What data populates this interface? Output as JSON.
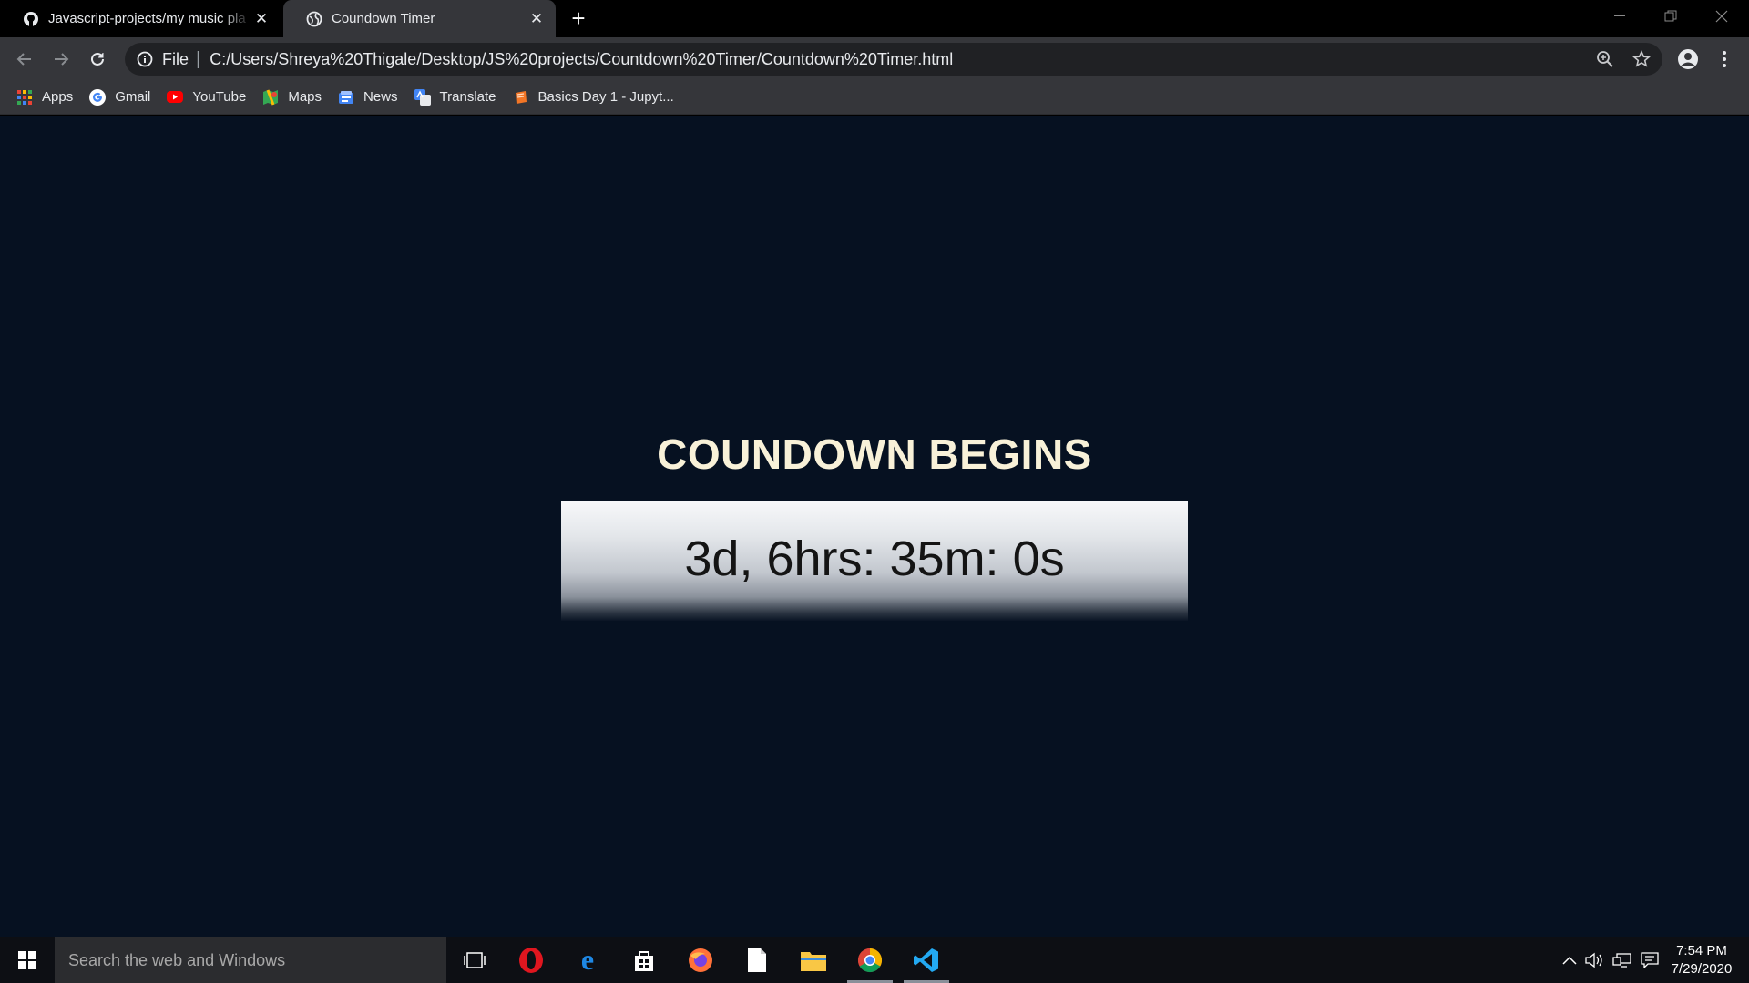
{
  "browser": {
    "tabs": [
      {
        "title": "Javascript-projects/my music pla",
        "active": false,
        "icon": "github-icon"
      },
      {
        "title": "Coundown Timer",
        "active": true,
        "icon": "globe-icon"
      }
    ],
    "omnibox": {
      "scheme_label": "File",
      "url": "C:/Users/Shreya%20Thigale/Desktop/JS%20projects/Countdown%20Timer/Countdown%20Timer.html"
    },
    "bookmarks": [
      {
        "label": "Apps",
        "icon": "apps-grid-icon"
      },
      {
        "label": "Gmail",
        "icon": "google-icon"
      },
      {
        "label": "YouTube",
        "icon": "youtube-icon"
      },
      {
        "label": "Maps",
        "icon": "maps-icon"
      },
      {
        "label": "News",
        "icon": "news-icon"
      },
      {
        "label": "Translate",
        "icon": "translate-icon"
      },
      {
        "label": "Basics Day 1 - Jupyt...",
        "icon": "jupyter-icon"
      }
    ]
  },
  "page": {
    "heading": "COUNDOWN BEGINS",
    "timer": "3d, 6hrs: 35m: 0s",
    "background_color": "#061121",
    "heading_color": "#f8f1d8"
  },
  "taskbar": {
    "search_placeholder": "Search the web and Windows",
    "time": "7:54 PM",
    "date": "7/29/2020",
    "apps": [
      "task-view",
      "opera",
      "edge",
      "store",
      "firefox",
      "file",
      "file-explorer",
      "chrome",
      "vscode"
    ]
  }
}
